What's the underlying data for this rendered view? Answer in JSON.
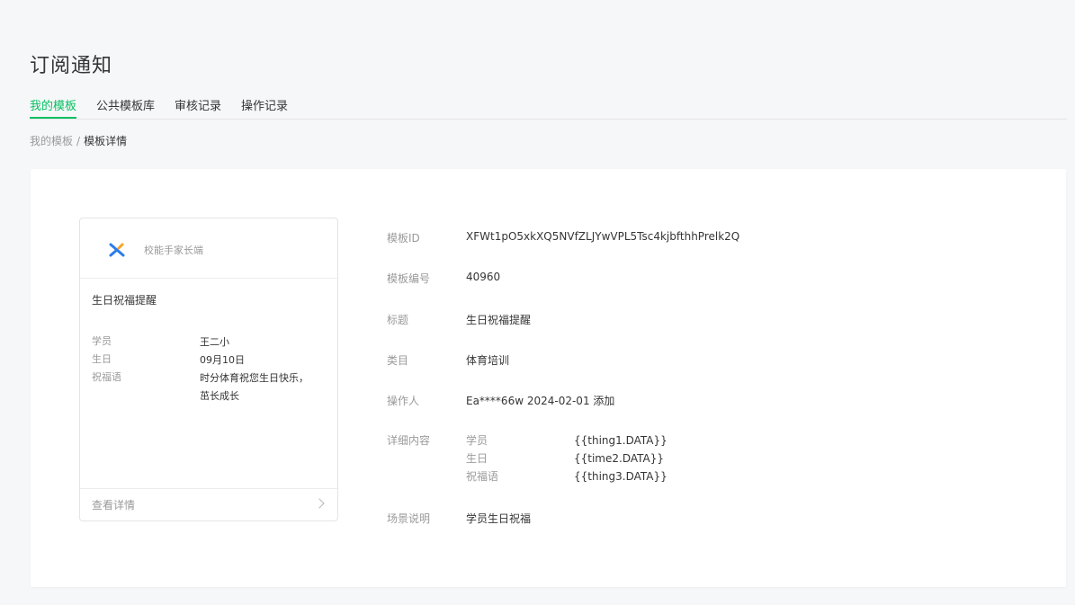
{
  "header": {
    "title": "订阅通知"
  },
  "tabs": [
    {
      "label": "我的模板",
      "active": true
    },
    {
      "label": "公共模板库",
      "active": false
    },
    {
      "label": "审核记录",
      "active": false
    },
    {
      "label": "操作记录",
      "active": false
    }
  ],
  "breadcrumb": {
    "parent": "我的模板",
    "separator": "/",
    "current": "模板详情"
  },
  "preview_card": {
    "app_name": "校能手家长端",
    "title": "生日祝福提醒",
    "fields": [
      {
        "label": "学员",
        "value": "王二小"
      },
      {
        "label": "生日",
        "value": "09月10日"
      },
      {
        "label": "祝福语",
        "value": "时分体育祝您生日快乐，茁长成长"
      }
    ],
    "footer_label": "查看详情"
  },
  "details": {
    "template_id": {
      "label": "模板ID",
      "value": "XFWt1pO5xkXQ5NVfZLJYwVPL5Tsc4kjbfthhPrelk2Q"
    },
    "template_number": {
      "label": "模板编号",
      "value": "40960"
    },
    "title": {
      "label": "标题",
      "value": "生日祝福提醒"
    },
    "category": {
      "label": "类目",
      "value": "体育培训"
    },
    "operator": {
      "label": "操作人",
      "value": "Ea****66w 2024-02-01 添加"
    },
    "content": {
      "label": "详细内容",
      "fields": [
        {
          "label": "学员",
          "value": "{{thing1.DATA}}"
        },
        {
          "label": "生日",
          "value": "{{time2.DATA}}"
        },
        {
          "label": "祝福语",
          "value": "{{thing3.DATA}}"
        }
      ]
    },
    "scene": {
      "label": "场景说明",
      "value": "学员生日祝福"
    }
  },
  "colors": {
    "accent": "#07c160",
    "logo_blue": "#2b7de9",
    "logo_orange": "#f5a623"
  }
}
